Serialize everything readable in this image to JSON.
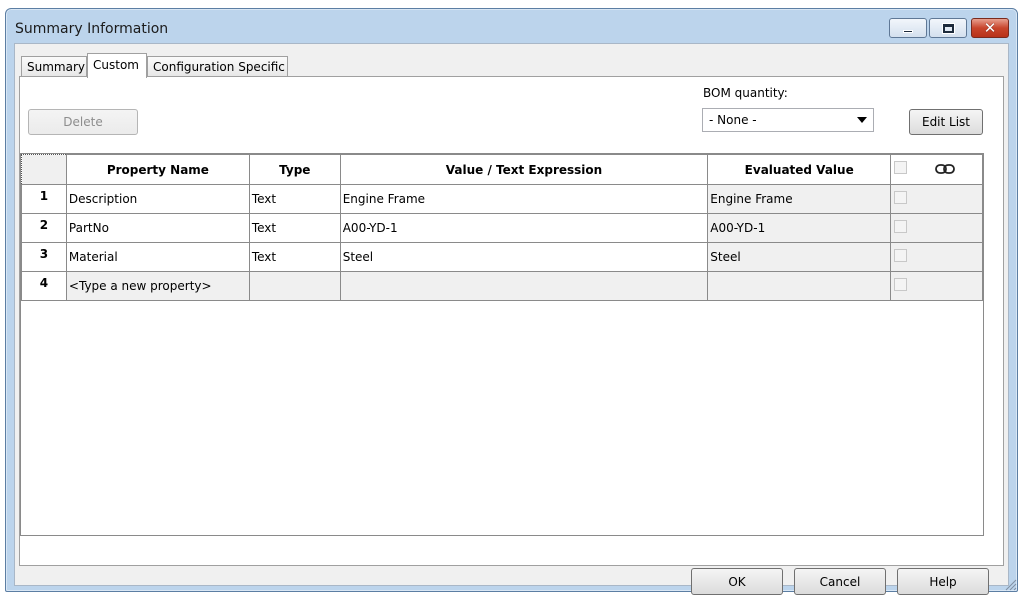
{
  "window": {
    "title": "Summary Information",
    "controls": [
      "minimize-icon",
      "maximize-icon",
      "close-icon"
    ]
  },
  "tabs": [
    {
      "label": "Summary",
      "active": false
    },
    {
      "label": "Custom",
      "active": true
    },
    {
      "label": "Configuration Specific",
      "active": false
    }
  ],
  "toolbar": {
    "delete_label": "Delete",
    "bom_label": "BOM quantity:",
    "bom_value": "- None -",
    "edit_list_label": "Edit List"
  },
  "grid": {
    "headers": [
      "Property Name",
      "Type",
      "Value / Text Expression",
      "Evaluated Value"
    ],
    "rows": [
      {
        "num": "1",
        "name": "Description",
        "type": "Text",
        "value": "Engine Frame",
        "evaluated": "Engine Frame"
      },
      {
        "num": "2",
        "name": "PartNo",
        "type": "Text",
        "value": "A00-YD-1",
        "evaluated": "A00-YD-1"
      },
      {
        "num": "3",
        "name": "Material",
        "type": "Text",
        "value": "Steel",
        "evaluated": "Steel"
      },
      {
        "num": "4",
        "name": "<Type a new property>",
        "type": "",
        "value": "",
        "evaluated": ""
      }
    ]
  },
  "footer": {
    "ok_label": "OK",
    "cancel_label": "Cancel",
    "help_label": "Help"
  },
  "colors": {
    "frame": "#bcd4ec",
    "close_button": "#c8452c",
    "dialog_bg": "#f0f0f0"
  }
}
